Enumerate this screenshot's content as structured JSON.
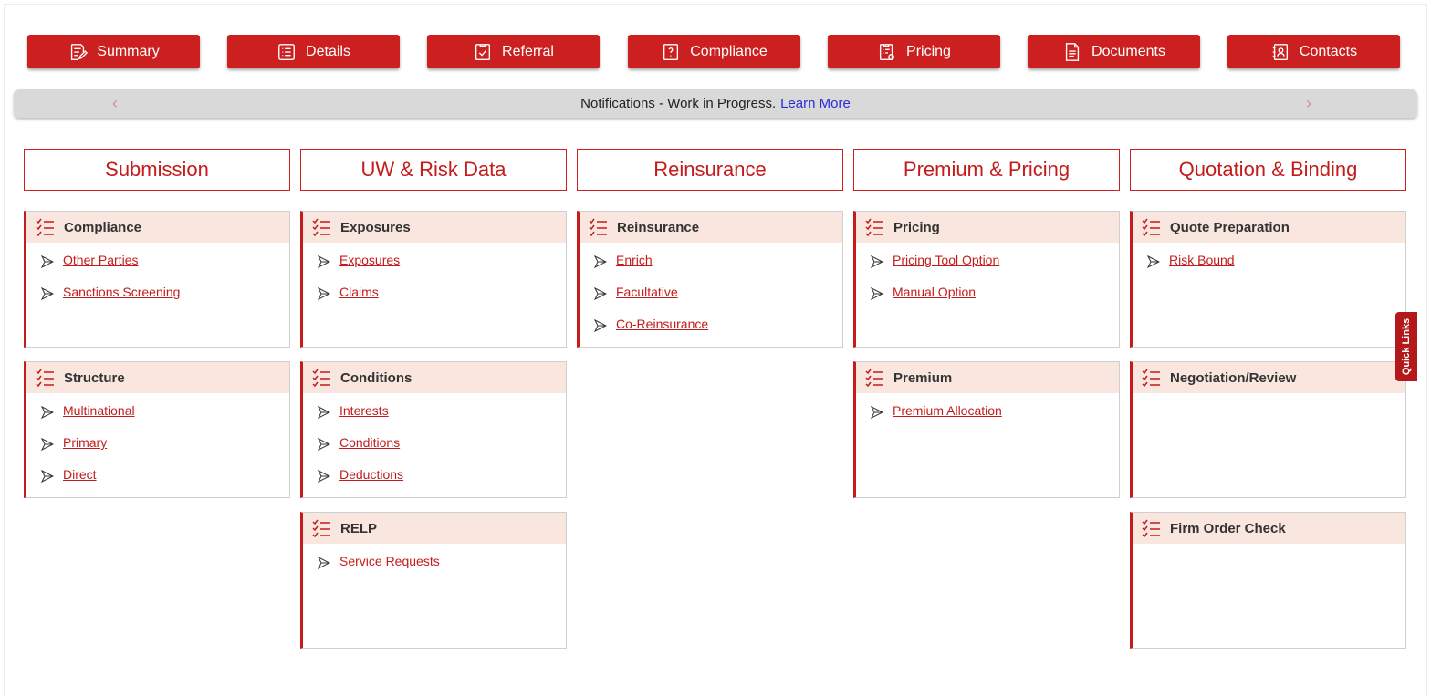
{
  "top_buttons": [
    {
      "label": "Summary",
      "icon": "summary-icon"
    },
    {
      "label": "Details",
      "icon": "details-icon"
    },
    {
      "label": "Referral",
      "icon": "referral-icon"
    },
    {
      "label": "Compliance",
      "icon": "compliance-icon"
    },
    {
      "label": "Pricing",
      "icon": "pricing-icon"
    },
    {
      "label": "Documents",
      "icon": "documents-icon"
    },
    {
      "label": "Contacts",
      "icon": "contacts-icon"
    }
  ],
  "notification": {
    "text": "Notifications - Work in Progress.",
    "link": "Learn More",
    "prev_glyph": "‹",
    "next_glyph": "›"
  },
  "columns": [
    {
      "title": "Submission"
    },
    {
      "title": "UW & Risk Data"
    },
    {
      "title": "Reinsurance"
    },
    {
      "title": "Premium & Pricing"
    },
    {
      "title": "Quotation & Binding"
    }
  ],
  "cards": {
    "submission": [
      {
        "title": "Compliance",
        "links": [
          "Other Parties",
          "Sanctions Screening"
        ]
      },
      {
        "title": "Structure",
        "links": [
          "Multinational",
          "Primary",
          "Direct"
        ]
      }
    ],
    "uw": [
      {
        "title": "Exposures",
        "links": [
          "Exposures",
          "Claims"
        ]
      },
      {
        "title": "Conditions",
        "links": [
          "Interests",
          "Conditions",
          "Deductions"
        ]
      },
      {
        "title": "RELP",
        "links": [
          "Service Requests"
        ]
      }
    ],
    "reinsurance": [
      {
        "title": "Reinsurance",
        "links": [
          "Enrich",
          "Facultative",
          "Co-Reinsurance"
        ]
      }
    ],
    "pricing": [
      {
        "title": "Pricing",
        "links": [
          "Pricing Tool Option",
          "Manual Option"
        ]
      },
      {
        "title": "Premium",
        "links": [
          "Premium Allocation"
        ]
      }
    ],
    "quotation": [
      {
        "title": "Quote Preparation",
        "links": [
          "Risk Bound"
        ]
      },
      {
        "title": "Negotiation/Review",
        "links": []
      },
      {
        "title": "Firm Order Check",
        "links": []
      }
    ]
  },
  "quick_links": "Quick Links",
  "colors": {
    "brand": "#cc2020",
    "card_header": "#f9e6df",
    "link": "#c41c1c"
  }
}
